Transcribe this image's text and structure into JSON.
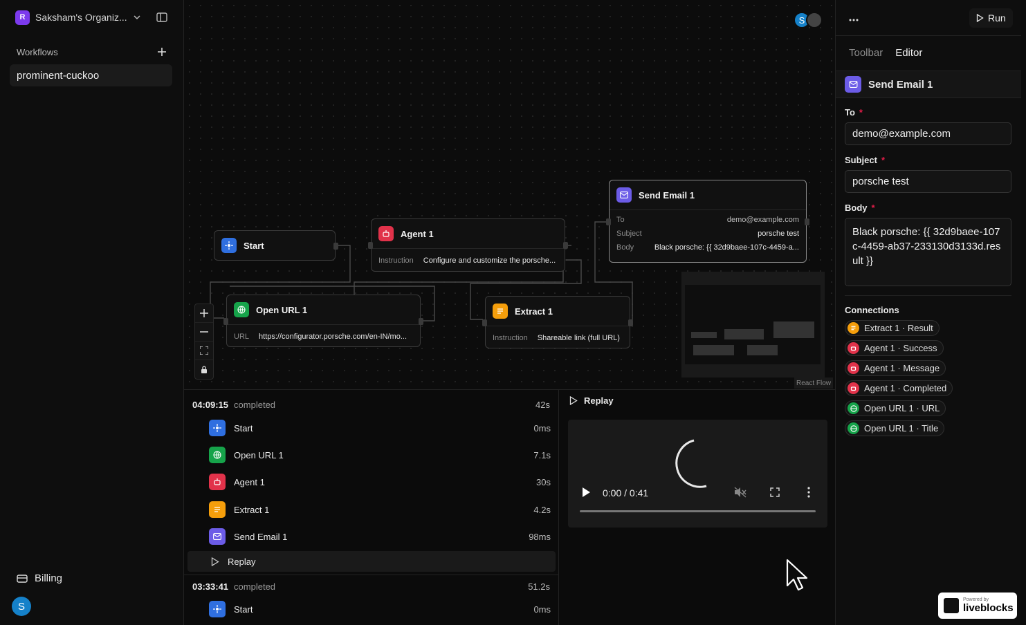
{
  "sidebar": {
    "org_initial": "R",
    "org_name": "Saksham's Organiz...",
    "workflows_heading": "Workflows",
    "workflows": [
      "prominent-cuckoo"
    ],
    "billing_label": "Billing",
    "user_initial": "S"
  },
  "canvas": {
    "presence_initial": "S",
    "react_flow_label": "React Flow",
    "nodes": {
      "start": {
        "title": "Start"
      },
      "agent": {
        "title": "Agent 1",
        "field_key": "Instruction",
        "field_value": "Configure and customize the porsche..."
      },
      "send_email": {
        "title": "Send Email 1",
        "to_key": "To",
        "to_value": "demo@example.com",
        "subject_key": "Subject",
        "subject_value": "porsche test",
        "body_key": "Body",
        "body_value": "Black porsche: {{ 32d9baee-107c-4459-a..."
      },
      "open_url": {
        "title": "Open URL 1",
        "field_key": "URL",
        "field_value": "https://configurator.porsche.com/en-IN/mo..."
      },
      "extract": {
        "title": "Extract 1",
        "field_key": "Instruction",
        "field_value": "Shareable link (full URL)"
      }
    }
  },
  "runs": [
    {
      "time": "04:09:15",
      "status": "completed",
      "duration": "42s",
      "steps": [
        {
          "name": "Start",
          "duration": "0ms",
          "color": "#2f6fe0",
          "icon": "start-icon"
        },
        {
          "name": "Open URL 1",
          "duration": "7.1s",
          "color": "#16a34a",
          "icon": "globe-icon"
        },
        {
          "name": "Agent 1",
          "duration": "30s",
          "color": "#e1324a",
          "icon": "robot-icon"
        },
        {
          "name": "Extract 1",
          "duration": "4.2s",
          "color": "#f59e0b",
          "icon": "extract-icon"
        },
        {
          "name": "Send Email 1",
          "duration": "98ms",
          "color": "#6c5ce7",
          "icon": "mail-icon"
        }
      ],
      "replay_label": "Replay"
    },
    {
      "time": "03:33:41",
      "status": "completed",
      "duration": "51.2s",
      "steps": [
        {
          "name": "Start",
          "duration": "0ms",
          "color": "#2f6fe0",
          "icon": "start-icon"
        }
      ]
    }
  ],
  "replay_panel": {
    "title": "Replay",
    "video_time": "0:00 / 0:41"
  },
  "panel": {
    "run_label": "Run",
    "tabs": [
      "Toolbar",
      "Editor"
    ],
    "active_tab": "Editor",
    "section_title": "Send Email 1",
    "to_label": "To",
    "to_value": "demo@example.com",
    "subject_label": "Subject",
    "subject_value": "porsche test",
    "body_label": "Body",
    "body_value": "Black porsche: {{ 32d9baee-107c-4459-ab37-233130d3133d.result }}",
    "connections_title": "Connections",
    "connections": [
      {
        "label": "Extract 1 · Result",
        "color": "#f59e0b"
      },
      {
        "label": "Agent 1 · Success",
        "color": "#e1324a"
      },
      {
        "label": "Agent 1 · Message",
        "color": "#e1324a"
      },
      {
        "label": "Agent 1 · Completed",
        "color": "#e1324a"
      },
      {
        "label": "Open URL 1 · URL",
        "color": "#16a34a"
      },
      {
        "label": "Open URL 1 · Title",
        "color": "#16a34a"
      }
    ]
  },
  "liveblocks": {
    "small": "Powered by",
    "big": "liveblocks"
  }
}
